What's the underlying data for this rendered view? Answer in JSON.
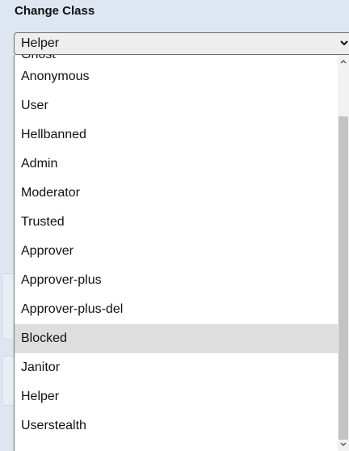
{
  "panel": {
    "title": "Change Class"
  },
  "select": {
    "value": "Helper",
    "chevron_icon": "chevron-down-icon"
  },
  "dropdown": {
    "partial_top_item": "Ghost",
    "items": [
      "Anonymous",
      "User",
      "Hellbanned",
      "Admin",
      "Moderator",
      "Trusted",
      "Approver",
      "Approver-plus",
      "Approver-plus-del",
      "Blocked",
      "Janitor",
      "Helper",
      "Userstealth"
    ],
    "highlighted_item": "Blocked",
    "scroll_up_icon": "scroll-up-arrow-icon",
    "scroll_down_icon": "scroll-down-arrow-icon"
  },
  "colors": {
    "page_background": "#dde6f1",
    "highlight": "#dedede",
    "scroll_thumb": "#c3c3c3"
  }
}
